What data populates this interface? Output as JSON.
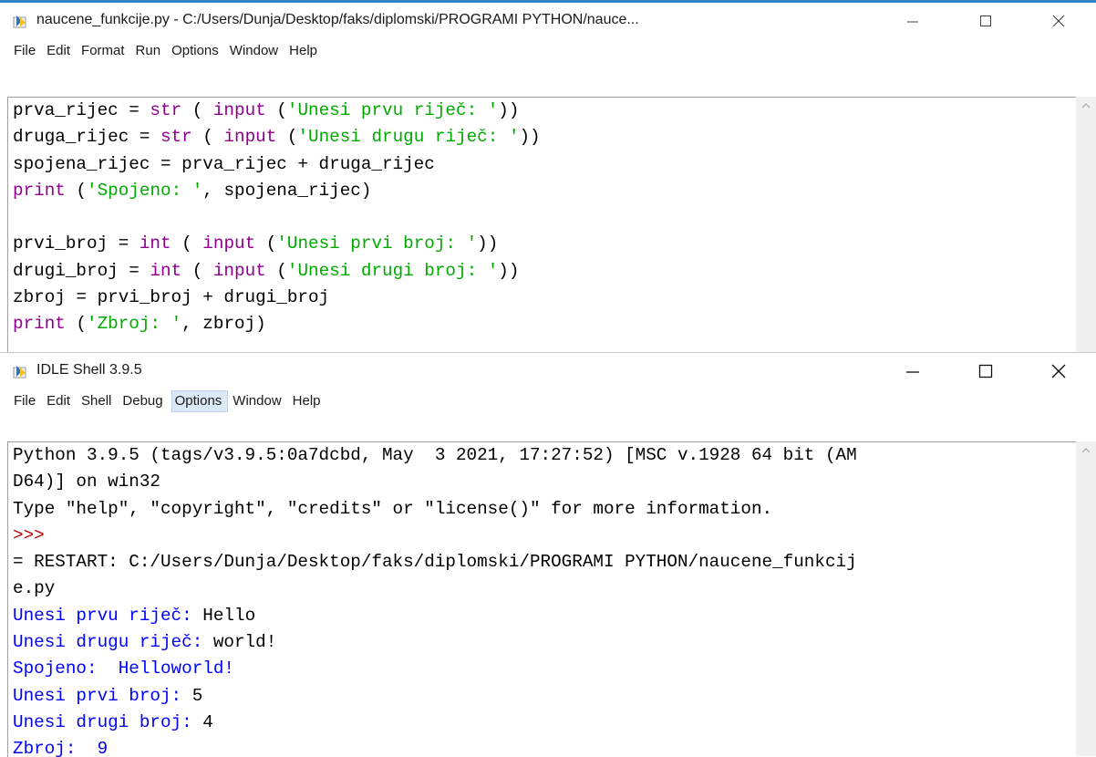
{
  "editor": {
    "title": "naucene_funkcije.py - C:/Users/Dunja/Desktop/faks/diplomski/PROGRAMI PYTHON/nauce...",
    "menu": [
      "File",
      "Edit",
      "Format",
      "Run",
      "Options",
      "Window",
      "Help"
    ],
    "code_lines": [
      [
        {
          "t": "prva_rijec = ",
          "c": ""
        },
        {
          "t": "str",
          "c": "kw-builtin"
        },
        {
          "t": " ( ",
          "c": ""
        },
        {
          "t": "input",
          "c": "kw-builtin"
        },
        {
          "t": " (",
          "c": ""
        },
        {
          "t": "'Unesi prvu riječ: '",
          "c": "str"
        },
        {
          "t": "))",
          "c": ""
        }
      ],
      [
        {
          "t": "druga_rijec = ",
          "c": ""
        },
        {
          "t": "str",
          "c": "kw-builtin"
        },
        {
          "t": " ( ",
          "c": ""
        },
        {
          "t": "input",
          "c": "kw-builtin"
        },
        {
          "t": " (",
          "c": ""
        },
        {
          "t": "'Unesi drugu riječ: '",
          "c": "str"
        },
        {
          "t": "))",
          "c": ""
        }
      ],
      [
        {
          "t": "spojena_rijec = prva_rijec + druga_rijec",
          "c": ""
        }
      ],
      [
        {
          "t": "print",
          "c": "kw-builtin"
        },
        {
          "t": " (",
          "c": ""
        },
        {
          "t": "'Spojeno: '",
          "c": "str"
        },
        {
          "t": ", spojena_rijec)",
          "c": ""
        }
      ],
      [],
      [
        {
          "t": "prvi_broj = ",
          "c": ""
        },
        {
          "t": "int",
          "c": "kw-builtin"
        },
        {
          "t": " ( ",
          "c": ""
        },
        {
          "t": "input",
          "c": "kw-builtin"
        },
        {
          "t": " (",
          "c": ""
        },
        {
          "t": "'Unesi prvi broj: '",
          "c": "str"
        },
        {
          "t": "))",
          "c": ""
        }
      ],
      [
        {
          "t": "drugi_broj = ",
          "c": ""
        },
        {
          "t": "int",
          "c": "kw-builtin"
        },
        {
          "t": " ( ",
          "c": ""
        },
        {
          "t": "input",
          "c": "kw-builtin"
        },
        {
          "t": " (",
          "c": ""
        },
        {
          "t": "'Unesi drugi broj: '",
          "c": "str"
        },
        {
          "t": "))",
          "c": ""
        }
      ],
      [
        {
          "t": "zbroj = prvi_broj + drugi_broj",
          "c": ""
        }
      ],
      [
        {
          "t": "print",
          "c": "kw-builtin"
        },
        {
          "t": " (",
          "c": ""
        },
        {
          "t": "'Zbroj: '",
          "c": "str"
        },
        {
          "t": ", zbroj)",
          "c": ""
        }
      ]
    ]
  },
  "shell": {
    "title": "IDLE Shell 3.9.5",
    "menu": [
      "File",
      "Edit",
      "Shell",
      "Debug",
      "Options",
      "Window",
      "Help"
    ],
    "active_menu_index": 4,
    "lines": [
      [
        {
          "t": "Python 3.9.5 (tags/v3.9.5:0a7dcbd, May  3 2021, 17:27:52) [MSC v.1928 64 bit (AM",
          "c": ""
        }
      ],
      [
        {
          "t": "D64)] on win32",
          "c": ""
        }
      ],
      [
        {
          "t": "Type \"help\", \"copyright\", \"credits\" or \"license()\" for more information.",
          "c": ""
        }
      ],
      [
        {
          "t": ">>>",
          "c": "prompt"
        }
      ],
      [
        {
          "t": "= RESTART: C:/Users/Dunja/Desktop/faks/diplomski/PROGRAMI PYTHON/naucene_funkcij",
          "c": ""
        }
      ],
      [
        {
          "t": "e.py",
          "c": ""
        }
      ],
      [
        {
          "t": "Unesi prvu riječ: ",
          "c": "out"
        },
        {
          "t": "Hello",
          "c": ""
        }
      ],
      [
        {
          "t": "Unesi drugu riječ: ",
          "c": "out"
        },
        {
          "t": "world!",
          "c": ""
        }
      ],
      [
        {
          "t": "Spojeno:  Helloworld!",
          "c": "out"
        }
      ],
      [
        {
          "t": "Unesi prvi broj: ",
          "c": "out"
        },
        {
          "t": "5",
          "c": ""
        }
      ],
      [
        {
          "t": "Unesi drugi broj: ",
          "c": "out"
        },
        {
          "t": "4",
          "c": ""
        }
      ],
      [
        {
          "t": "Zbroj:  9",
          "c": "out"
        }
      ]
    ]
  },
  "colors": {
    "builtin": "#900090",
    "string": "#00aa00",
    "prompt": "#c00000",
    "output": "#0000ff",
    "title_accent": "#2c86c6"
  },
  "icons": {
    "app": "idle-python-icon",
    "minimize": "minimize-icon",
    "maximize": "maximize-icon",
    "close": "close-icon",
    "scroll_up": "scroll-up-arrow-icon"
  }
}
